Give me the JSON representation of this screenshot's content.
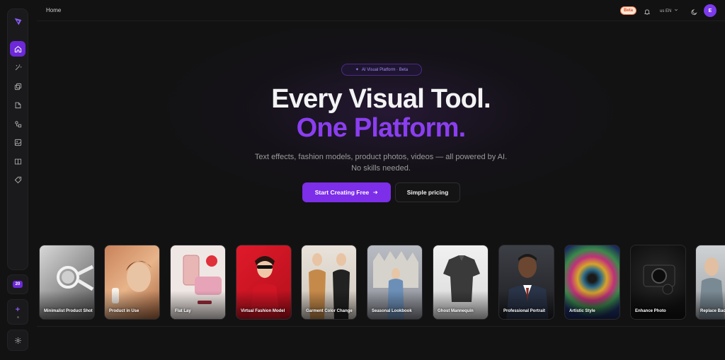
{
  "topbar": {
    "breadcrumb": "Home",
    "beta_label": "Beta",
    "language": "us  EN",
    "avatar_initial": "E"
  },
  "sidebar": {
    "items": [
      {
        "name": "home",
        "icon": "home-icon",
        "active": true
      },
      {
        "name": "magic-tools",
        "icon": "magic-wand-icon",
        "active": false
      },
      {
        "name": "copy",
        "icon": "copy-icon",
        "active": false
      },
      {
        "name": "files",
        "icon": "files-icon",
        "active": false
      },
      {
        "name": "shapes",
        "icon": "shapes-icon",
        "active": false
      },
      {
        "name": "images",
        "icon": "image-icon",
        "active": false
      },
      {
        "name": "library",
        "icon": "book-icon",
        "active": false
      },
      {
        "name": "pricing",
        "icon": "tag-icon",
        "active": false
      }
    ],
    "credits": "20",
    "add_label": "+"
  },
  "hero": {
    "badge": "AI Visual Platform · Beta",
    "title_line1": "Every Visual Tool.",
    "title_line2": "One Platform.",
    "subtitle": "Text effects, fashion models, product photos, videos — all powered by AI. No skills needed.",
    "cta_primary": "Start Creating Free",
    "cta_secondary": "Simple pricing"
  },
  "cards": [
    {
      "label": "Minimalist Product Shot"
    },
    {
      "label": "Product in Use"
    },
    {
      "label": "Flat Lay"
    },
    {
      "label": "Virtual Fashion Model"
    },
    {
      "label": "Garment Color Change"
    },
    {
      "label": "Seasonal Lookbook"
    },
    {
      "label": "Ghost Mannequin"
    },
    {
      "label": "Professional Portrait"
    },
    {
      "label": "Artistic Style"
    },
    {
      "label": "Enhance Photo"
    },
    {
      "label": "Replace Background"
    }
  ],
  "colors": {
    "accent": "#7c2ee8",
    "accent_text": "#8b3ef0",
    "background": "#121212"
  }
}
